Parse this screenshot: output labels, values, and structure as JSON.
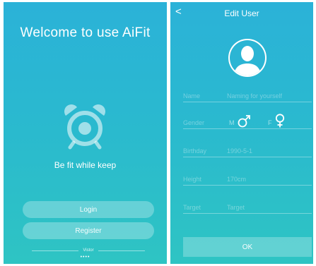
{
  "welcome": {
    "title": "Welcome to use AiFit",
    "tagline": "Be fit while keep",
    "login_label": "Login",
    "register_label": "Register",
    "visitor_label": "Vistor",
    "page_dots": "••••"
  },
  "edit_user": {
    "back_glyph": "<",
    "title": "Edit User",
    "name": {
      "label": "Name",
      "placeholder": "Naming for yourself"
    },
    "gender": {
      "label": "Gender",
      "male_label": "M",
      "female_label": "F"
    },
    "birthday": {
      "label": "Birthday",
      "value": "1990-5-1"
    },
    "height": {
      "label": "Height",
      "value": "170cm"
    },
    "target": {
      "label": "Target",
      "placeholder": "Target"
    },
    "ok_label": "OK"
  },
  "icons": {
    "clock": "alarm-clock-icon",
    "avatar": "user-avatar-icon",
    "male": "male-symbol-icon",
    "female": "female-symbol-icon",
    "back": "back-chevron-icon"
  },
  "colors": {
    "gradient_top": "#2bb2d8",
    "gradient_bottom": "#2ec4c3"
  }
}
